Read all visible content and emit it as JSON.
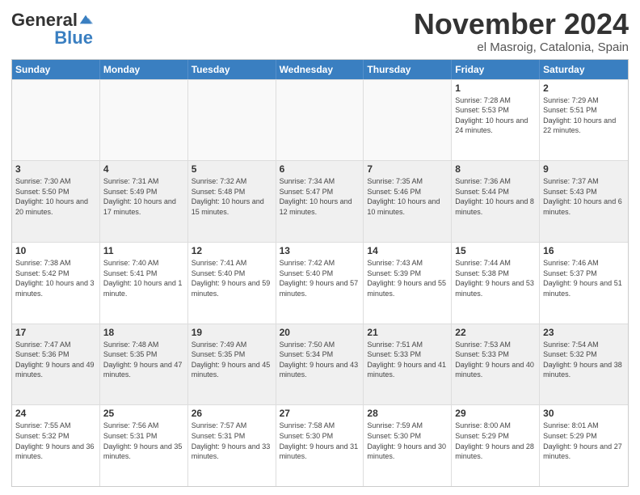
{
  "header": {
    "logo_general": "General",
    "logo_blue": "Blue",
    "month_title": "November 2024",
    "location": "el Masroig, Catalonia, Spain"
  },
  "calendar": {
    "days": [
      "Sunday",
      "Monday",
      "Tuesday",
      "Wednesday",
      "Thursday",
      "Friday",
      "Saturday"
    ],
    "rows": [
      [
        {
          "day": "",
          "info": "",
          "empty": true
        },
        {
          "day": "",
          "info": "",
          "empty": true
        },
        {
          "day": "",
          "info": "",
          "empty": true
        },
        {
          "day": "",
          "info": "",
          "empty": true
        },
        {
          "day": "",
          "info": "",
          "empty": true
        },
        {
          "day": "1",
          "info": "Sunrise: 7:28 AM\nSunset: 5:53 PM\nDaylight: 10 hours and 24 minutes."
        },
        {
          "day": "2",
          "info": "Sunrise: 7:29 AM\nSunset: 5:51 PM\nDaylight: 10 hours and 22 minutes."
        }
      ],
      [
        {
          "day": "3",
          "info": "Sunrise: 7:30 AM\nSunset: 5:50 PM\nDaylight: 10 hours and 20 minutes."
        },
        {
          "day": "4",
          "info": "Sunrise: 7:31 AM\nSunset: 5:49 PM\nDaylight: 10 hours and 17 minutes."
        },
        {
          "day": "5",
          "info": "Sunrise: 7:32 AM\nSunset: 5:48 PM\nDaylight: 10 hours and 15 minutes."
        },
        {
          "day": "6",
          "info": "Sunrise: 7:34 AM\nSunset: 5:47 PM\nDaylight: 10 hours and 12 minutes."
        },
        {
          "day": "7",
          "info": "Sunrise: 7:35 AM\nSunset: 5:46 PM\nDaylight: 10 hours and 10 minutes."
        },
        {
          "day": "8",
          "info": "Sunrise: 7:36 AM\nSunset: 5:44 PM\nDaylight: 10 hours and 8 minutes."
        },
        {
          "day": "9",
          "info": "Sunrise: 7:37 AM\nSunset: 5:43 PM\nDaylight: 10 hours and 6 minutes."
        }
      ],
      [
        {
          "day": "10",
          "info": "Sunrise: 7:38 AM\nSunset: 5:42 PM\nDaylight: 10 hours and 3 minutes."
        },
        {
          "day": "11",
          "info": "Sunrise: 7:40 AM\nSunset: 5:41 PM\nDaylight: 10 hours and 1 minute."
        },
        {
          "day": "12",
          "info": "Sunrise: 7:41 AM\nSunset: 5:40 PM\nDaylight: 9 hours and 59 minutes."
        },
        {
          "day": "13",
          "info": "Sunrise: 7:42 AM\nSunset: 5:40 PM\nDaylight: 9 hours and 57 minutes."
        },
        {
          "day": "14",
          "info": "Sunrise: 7:43 AM\nSunset: 5:39 PM\nDaylight: 9 hours and 55 minutes."
        },
        {
          "day": "15",
          "info": "Sunrise: 7:44 AM\nSunset: 5:38 PM\nDaylight: 9 hours and 53 minutes."
        },
        {
          "day": "16",
          "info": "Sunrise: 7:46 AM\nSunset: 5:37 PM\nDaylight: 9 hours and 51 minutes."
        }
      ],
      [
        {
          "day": "17",
          "info": "Sunrise: 7:47 AM\nSunset: 5:36 PM\nDaylight: 9 hours and 49 minutes."
        },
        {
          "day": "18",
          "info": "Sunrise: 7:48 AM\nSunset: 5:35 PM\nDaylight: 9 hours and 47 minutes."
        },
        {
          "day": "19",
          "info": "Sunrise: 7:49 AM\nSunset: 5:35 PM\nDaylight: 9 hours and 45 minutes."
        },
        {
          "day": "20",
          "info": "Sunrise: 7:50 AM\nSunset: 5:34 PM\nDaylight: 9 hours and 43 minutes."
        },
        {
          "day": "21",
          "info": "Sunrise: 7:51 AM\nSunset: 5:33 PM\nDaylight: 9 hours and 41 minutes."
        },
        {
          "day": "22",
          "info": "Sunrise: 7:53 AM\nSunset: 5:33 PM\nDaylight: 9 hours and 40 minutes."
        },
        {
          "day": "23",
          "info": "Sunrise: 7:54 AM\nSunset: 5:32 PM\nDaylight: 9 hours and 38 minutes."
        }
      ],
      [
        {
          "day": "24",
          "info": "Sunrise: 7:55 AM\nSunset: 5:32 PM\nDaylight: 9 hours and 36 minutes."
        },
        {
          "day": "25",
          "info": "Sunrise: 7:56 AM\nSunset: 5:31 PM\nDaylight: 9 hours and 35 minutes."
        },
        {
          "day": "26",
          "info": "Sunrise: 7:57 AM\nSunset: 5:31 PM\nDaylight: 9 hours and 33 minutes."
        },
        {
          "day": "27",
          "info": "Sunrise: 7:58 AM\nSunset: 5:30 PM\nDaylight: 9 hours and 31 minutes."
        },
        {
          "day": "28",
          "info": "Sunrise: 7:59 AM\nSunset: 5:30 PM\nDaylight: 9 hours and 30 minutes."
        },
        {
          "day": "29",
          "info": "Sunrise: 8:00 AM\nSunset: 5:29 PM\nDaylight: 9 hours and 28 minutes."
        },
        {
          "day": "30",
          "info": "Sunrise: 8:01 AM\nSunset: 5:29 PM\nDaylight: 9 hours and 27 minutes."
        }
      ]
    ]
  }
}
